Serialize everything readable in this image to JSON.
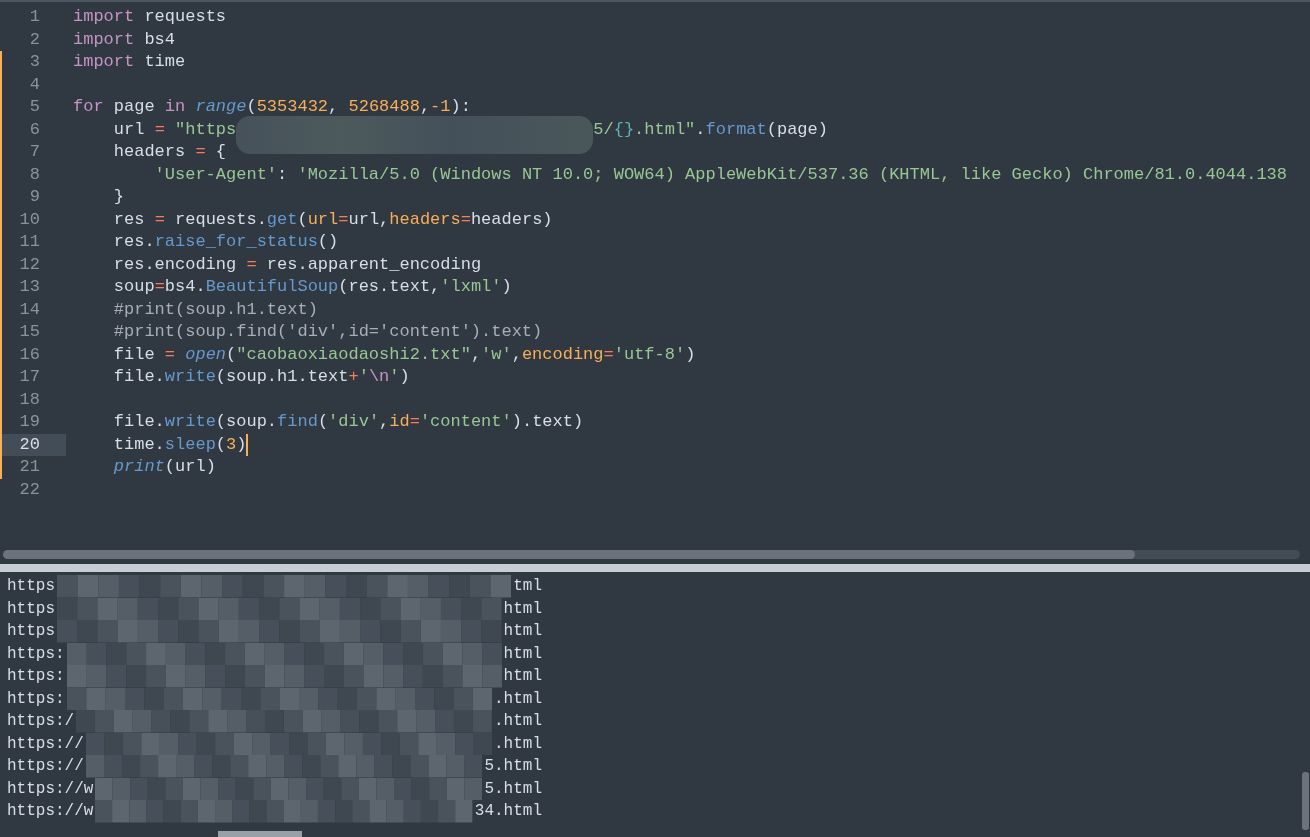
{
  "editor": {
    "lines": [
      {
        "number": "1",
        "modified": false,
        "current": false,
        "tokens": [
          {
            "text": "import",
            "kind": "keyword"
          },
          {
            "text": " requests",
            "kind": "plain"
          }
        ]
      },
      {
        "number": "2",
        "modified": false,
        "current": false,
        "tokens": [
          {
            "text": "import",
            "kind": "keyword"
          },
          {
            "text": " bs4",
            "kind": "plain"
          }
        ]
      },
      {
        "number": "3",
        "modified": true,
        "current": false,
        "tokens": [
          {
            "text": "import",
            "kind": "keyword"
          },
          {
            "text": " time",
            "kind": "plain"
          }
        ]
      },
      {
        "number": "4",
        "modified": true,
        "current": false
      },
      {
        "number": "5",
        "modified": true,
        "current": false,
        "tokens": [
          {
            "text": "for",
            "kind": "keyword"
          },
          {
            "text": " page ",
            "kind": "plain"
          },
          {
            "text": "in ",
            "kind": "keyword"
          },
          {
            "text": "range",
            "kind": "builtin"
          },
          {
            "text": "(",
            "kind": "plain"
          },
          {
            "text": "5353432",
            "kind": "number"
          },
          {
            "text": ", ",
            "kind": "plain"
          },
          {
            "text": "5268488",
            "kind": "number"
          },
          {
            "text": ",",
            "kind": "plain"
          },
          {
            "text": "-1",
            "kind": "number"
          },
          {
            "text": "):",
            "kind": "plain"
          }
        ]
      },
      {
        "number": "6",
        "modified": true,
        "current": false,
        "tokens": [
          {
            "text": "    url ",
            "kind": "plain"
          },
          {
            "text": "=",
            "kind": "operator"
          },
          {
            "text": " \"https",
            "kind": "string"
          },
          {
            "kind": "redacted"
          },
          {
            "text": "5/",
            "kind": "string"
          },
          {
            "text": "{}",
            "kind": "punct"
          },
          {
            "text": ".html\"",
            "kind": "string"
          },
          {
            "text": ".",
            "kind": "plain"
          },
          {
            "text": "format",
            "kind": "method"
          },
          {
            "text": "(page)",
            "kind": "plain"
          }
        ]
      },
      {
        "number": "7",
        "modified": true,
        "current": false,
        "tokens": [
          {
            "text": "    headers ",
            "kind": "plain"
          },
          {
            "text": "=",
            "kind": "operator"
          },
          {
            "text": " {",
            "kind": "plain"
          }
        ]
      },
      {
        "number": "8",
        "modified": true,
        "current": false,
        "tokens": [
          {
            "text": "        'User-Agent'",
            "kind": "string"
          },
          {
            "text": ": ",
            "kind": "plain"
          },
          {
            "text": "'Mozilla/5.0 (Windows NT 10.0; WOW64) AppleWebKit/537.36 (KHTML, like Gecko) Chrome/81.0.4044.138",
            "kind": "string"
          }
        ]
      },
      {
        "number": "9",
        "modified": true,
        "current": false,
        "tokens": [
          {
            "text": "    }",
            "kind": "plain"
          }
        ]
      },
      {
        "number": "10",
        "modified": true,
        "current": false,
        "tokens": [
          {
            "text": "    res ",
            "kind": "plain"
          },
          {
            "text": "=",
            "kind": "operator"
          },
          {
            "text": " requests.",
            "kind": "plain"
          },
          {
            "text": "get",
            "kind": "method"
          },
          {
            "text": "(",
            "kind": "plain"
          },
          {
            "text": "url",
            "kind": "kwarg"
          },
          {
            "text": "=",
            "kind": "operator"
          },
          {
            "text": "url,",
            "kind": "plain"
          },
          {
            "text": "headers",
            "kind": "kwarg"
          },
          {
            "text": "=",
            "kind": "operator"
          },
          {
            "text": "headers)",
            "kind": "plain"
          }
        ]
      },
      {
        "number": "11",
        "modified": true,
        "current": false,
        "tokens": [
          {
            "text": "    res.",
            "kind": "plain"
          },
          {
            "text": "raise_for_status",
            "kind": "method"
          },
          {
            "text": "()",
            "kind": "plain"
          }
        ]
      },
      {
        "number": "12",
        "modified": true,
        "current": false,
        "tokens": [
          {
            "text": "    res.encoding ",
            "kind": "plain"
          },
          {
            "text": "=",
            "kind": "operator"
          },
          {
            "text": " res.apparent_encoding",
            "kind": "plain"
          }
        ]
      },
      {
        "number": "13",
        "modified": true,
        "current": false,
        "tokens": [
          {
            "text": "    soup",
            "kind": "plain"
          },
          {
            "text": "=",
            "kind": "operator"
          },
          {
            "text": "bs4.",
            "kind": "plain"
          },
          {
            "text": "BeautifulSoup",
            "kind": "method"
          },
          {
            "text": "(res.text,",
            "kind": "plain"
          },
          {
            "text": "'lxml'",
            "kind": "string"
          },
          {
            "text": ")",
            "kind": "plain"
          }
        ]
      },
      {
        "number": "14",
        "modified": true,
        "current": false,
        "tokens": [
          {
            "text": "    #print(soup.h1.text)",
            "kind": "comment"
          }
        ]
      },
      {
        "number": "15",
        "modified": true,
        "current": false,
        "tokens": [
          {
            "text": "    #print(soup.find('div',id='content').text)",
            "kind": "comment"
          }
        ]
      },
      {
        "number": "16",
        "modified": true,
        "current": false,
        "tokens": [
          {
            "text": "    file ",
            "kind": "plain"
          },
          {
            "text": "=",
            "kind": "operator"
          },
          {
            "text": " open",
            "kind": "builtin"
          },
          {
            "text": "(",
            "kind": "plain"
          },
          {
            "text": "\"caobaoxiaodaoshi2.txt\"",
            "kind": "string"
          },
          {
            "text": ",",
            "kind": "plain"
          },
          {
            "text": "'w'",
            "kind": "string"
          },
          {
            "text": ",",
            "kind": "plain"
          },
          {
            "text": "encoding",
            "kind": "kwarg"
          },
          {
            "text": "=",
            "kind": "operator"
          },
          {
            "text": "'utf-8'",
            "kind": "string"
          },
          {
            "text": ")",
            "kind": "plain"
          }
        ]
      },
      {
        "number": "17",
        "modified": true,
        "current": false,
        "tokens": [
          {
            "text": "    file.",
            "kind": "plain"
          },
          {
            "text": "write",
            "kind": "method"
          },
          {
            "text": "(soup.h1.text",
            "kind": "plain"
          },
          {
            "text": "+",
            "kind": "operator"
          },
          {
            "text": "'",
            "kind": "string"
          },
          {
            "text": "\\n",
            "kind": "escape"
          },
          {
            "text": "'",
            "kind": "string"
          },
          {
            "text": ")",
            "kind": "plain"
          }
        ]
      },
      {
        "number": "18",
        "modified": true,
        "current": false
      },
      {
        "number": "19",
        "modified": true,
        "current": false,
        "tokens": [
          {
            "text": "    file.",
            "kind": "plain"
          },
          {
            "text": "write",
            "kind": "method"
          },
          {
            "text": "(soup.",
            "kind": "plain"
          },
          {
            "text": "find",
            "kind": "method"
          },
          {
            "text": "(",
            "kind": "plain"
          },
          {
            "text": "'div'",
            "kind": "string"
          },
          {
            "text": ",",
            "kind": "plain"
          },
          {
            "text": "id",
            "kind": "kwarg"
          },
          {
            "text": "=",
            "kind": "operator"
          },
          {
            "text": "'content'",
            "kind": "string"
          },
          {
            "text": ").text)",
            "kind": "plain"
          }
        ]
      },
      {
        "number": "20",
        "modified": true,
        "current": true,
        "tokens": [
          {
            "text": "    time.",
            "kind": "plain"
          },
          {
            "text": "sleep",
            "kind": "method"
          },
          {
            "text": "(",
            "kind": "plain"
          },
          {
            "text": "3",
            "kind": "number"
          },
          {
            "text": ")",
            "kind": "plain"
          }
        ]
      },
      {
        "number": "21",
        "modified": true,
        "current": false,
        "tokens": [
          {
            "text": "    print",
            "kind": "builtin"
          },
          {
            "text": "(url)",
            "kind": "plain"
          }
        ]
      },
      {
        "number": "22",
        "modified": false,
        "current": false
      }
    ]
  },
  "output": {
    "lines": [
      {
        "start": "https",
        "end": "tml"
      },
      {
        "start": "https",
        "end": "html"
      },
      {
        "start": "https",
        "end": "html"
      },
      {
        "start": "https:",
        "end": "html"
      },
      {
        "start": "https:",
        "end": "html"
      },
      {
        "start": "https:",
        "end": ".html"
      },
      {
        "start": "https:/",
        "end": ".html"
      },
      {
        "start": "https://",
        "end": ".html"
      },
      {
        "start": "https://",
        "end": "5.html"
      },
      {
        "start": "https://w",
        "end": "5.html"
      },
      {
        "start": "https://w",
        "end": "34.html"
      }
    ]
  }
}
